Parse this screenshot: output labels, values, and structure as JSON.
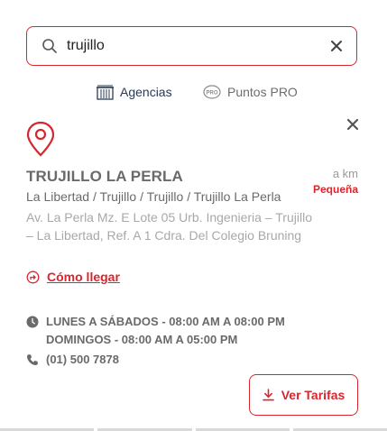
{
  "search": {
    "value": "trujillo",
    "placeholder": ""
  },
  "tabs": [
    {
      "label": "Agencias",
      "icon": "building-icon",
      "active": true
    },
    {
      "label": "Puntos PRO",
      "icon": "pro-badge-icon",
      "active": false
    }
  ],
  "pro_icon_text": "PRO",
  "agency": {
    "name": "TRUJILLO LA PERLA",
    "distance": "a km",
    "size": "Pequeña",
    "location_path": "La Libertad / Trujillo / Trujillo / Trujillo La Perla",
    "address_line1": "Av. La Perla Mz. E Lote 05 Urb. Ingenieria – Trujillo",
    "address_line2": "– La Libertad, Ref. A 1 Cdra. Del Colegio Bruning",
    "directions_label": "Cómo llegar",
    "hours_weekdays": "LUNES A SÁBADOS - 08:00 AM A 08:00 PM",
    "hours_sunday": "DOMINGOS - 08:00 AM A 05:00 PM",
    "phone": "(01) 500 7878"
  },
  "actions": {
    "tariff_label": "Ver Tarifas"
  },
  "colors": {
    "accent": "#d7262e",
    "text": "#6a6a6a",
    "muted": "#a8a8a8",
    "tab_active": "#2a3a55"
  }
}
